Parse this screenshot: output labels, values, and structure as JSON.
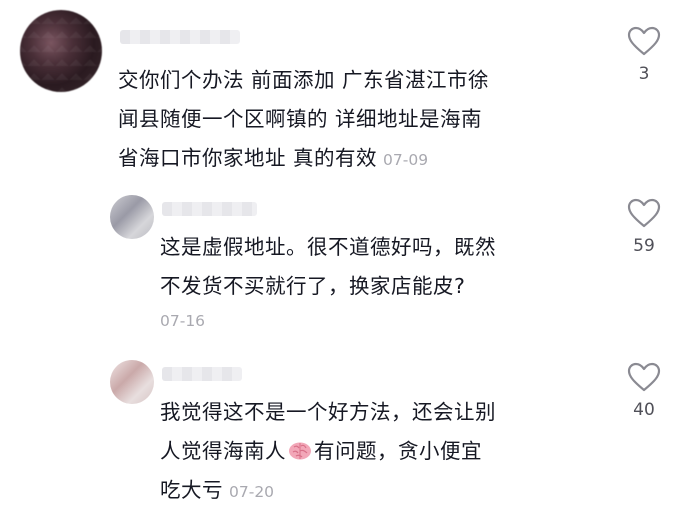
{
  "comments": [
    {
      "text": "交你们个办法 前面添加 广东省湛江市徐闻县随便一个区啊镇的 详细地址是海南省海口市你家地址 真的有效",
      "lines": [
        "交你们个办法 前面添加 广东省湛江市徐",
        "闻县随便一个区啊镇的 详细地址是海南",
        "省海口市你家地址 真的有效"
      ],
      "date": "07-09",
      "likes": "3"
    },
    {
      "text": "这是虚假地址。很不道德好吗，既然不发货不买就行了，换家店能皮?",
      "lines": [
        "这是虚假地址。很不道德好吗，既然",
        "不发货不买就行了，换家店能皮?"
      ],
      "date": "07-16",
      "likes": "59"
    },
    {
      "lines": [
        "我觉得这不是一个好方法，还会让别",
        "人觉得海南人",
        "有问题，贪小便宜",
        "吃大亏"
      ],
      "emoji": "brain-emoji",
      "date": "07-20",
      "likes": "40"
    }
  ],
  "colors": {
    "text": "#161823",
    "muted": "#a9a9b0",
    "icon": "#8a8a92"
  },
  "icons": {
    "like": "heart-outline-icon",
    "emoji": "brain-emoji-icon"
  }
}
